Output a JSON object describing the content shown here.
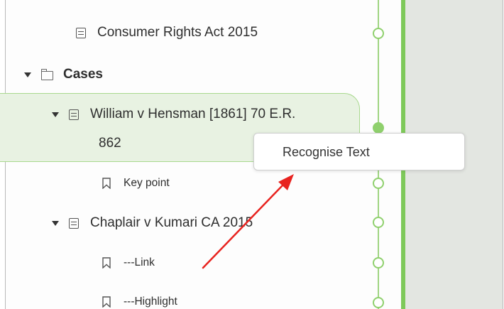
{
  "outline": {
    "items": [
      {
        "label": "Consumer Rights Act 2015"
      },
      {
        "label": "Cases"
      },
      {
        "label_line1": "William v Hensman [1861] 70 E.R.",
        "label_line2": "862"
      },
      {
        "label": "Key point"
      },
      {
        "label": "Chaplair v Kumari CA 2015"
      },
      {
        "label": "---Link"
      },
      {
        "label": "---Highlight"
      }
    ]
  },
  "context_menu": {
    "items": [
      {
        "label": "Recognise Text"
      }
    ]
  },
  "icons": {
    "document": "document-icon",
    "folder": "folder-icon",
    "bookmark": "bookmark-icon",
    "caret": "chevron-down-icon"
  },
  "colors": {
    "accent_green": "#7ec95a",
    "selection_bg": "#e8f2e2",
    "annotation_arrow": "#e8231f"
  }
}
